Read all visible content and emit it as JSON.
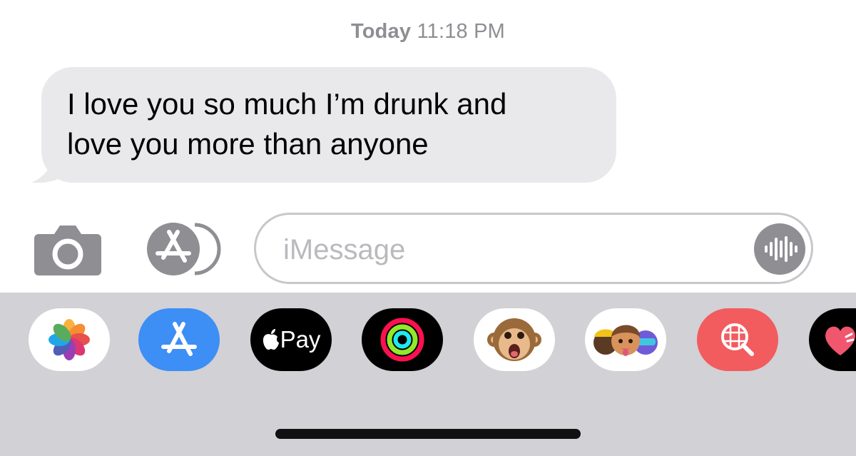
{
  "conversation": {
    "timestamp": {
      "day": "Today",
      "time": "11:18 PM"
    },
    "messages": [
      {
        "direction": "received",
        "lines": [
          "I love you so much I’m drunk and",
          "love you more than anyone"
        ]
      }
    ]
  },
  "composer": {
    "placeholder": "iMessage",
    "value": "",
    "camera_icon": "camera-icon",
    "apps_icon": "app-store-icon",
    "voice_icon": "waveform-icon"
  },
  "app_drawer": {
    "apps": [
      {
        "name": "Photos",
        "icon": "photos-icon"
      },
      {
        "name": "App Store",
        "icon": "app-store-icon"
      },
      {
        "name": "Apple Pay",
        "icon": "apple-pay-icon",
        "label": "Pay"
      },
      {
        "name": "Activity",
        "icon": "activity-rings-icon"
      },
      {
        "name": "Animoji",
        "icon": "monkey-animoji-icon"
      },
      {
        "name": "Memoji Stickers",
        "icon": "memoji-stickers-icon"
      },
      {
        "name": "Images Search",
        "icon": "globe-search-icon"
      },
      {
        "name": "Digital Touch",
        "icon": "heart-touch-icon"
      }
    ]
  },
  "colors": {
    "bubble_received": "#e9e9eb",
    "secondary_gray": "#8e8e93",
    "drawer_background": "#d1d1d6",
    "app_store_blue": "#3d8ef5",
    "search_red": "#f25c5e"
  }
}
